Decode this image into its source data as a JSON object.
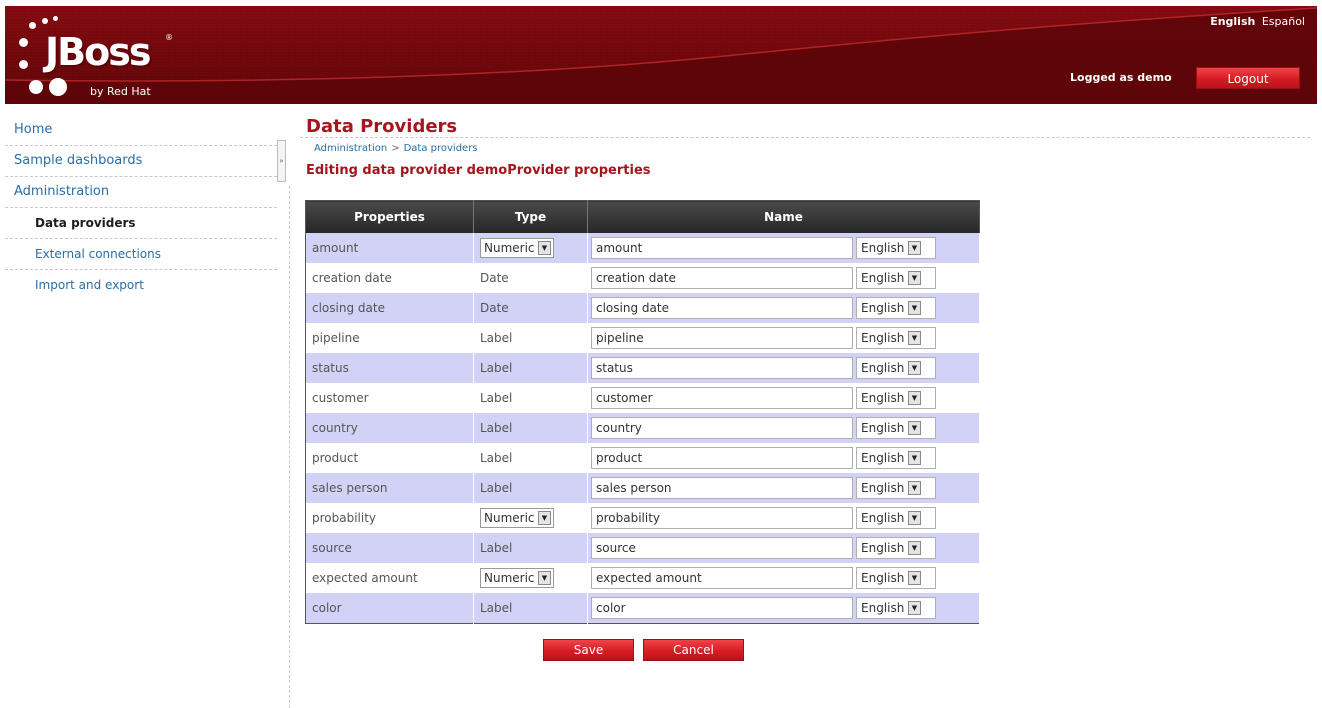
{
  "header": {
    "logo_text": "JBoss",
    "logo_reg": "®",
    "logo_sub": "by Red Hat",
    "languages": [
      "English",
      "Español"
    ],
    "active_language": "English",
    "logged_text": "Logged as demo",
    "logout_label": "Logout"
  },
  "sidebar": {
    "items": [
      {
        "label": "Home",
        "level": 0
      },
      {
        "label": "Sample dashboards",
        "level": 0
      },
      {
        "label": "Administration",
        "level": 0
      },
      {
        "label": "Data providers",
        "level": 1,
        "active": true
      },
      {
        "label": "External connections",
        "level": 1
      },
      {
        "label": "Import and export",
        "level": 1
      }
    ]
  },
  "main": {
    "title": "Data Providers",
    "breadcrumb": [
      "Administration",
      "Data providers"
    ],
    "breadcrumb_sep": ">",
    "subtitle": "Editing data provider demoProvider properties",
    "columns": [
      "Properties",
      "Type",
      "Name"
    ],
    "rows": [
      {
        "property": "amount",
        "type": "Numeric",
        "type_select": true,
        "name": "amount",
        "lang": "English"
      },
      {
        "property": "creation date",
        "type": "Date",
        "type_select": false,
        "name": "creation date",
        "lang": "English"
      },
      {
        "property": "closing date",
        "type": "Date",
        "type_select": false,
        "name": "closing date",
        "lang": "English"
      },
      {
        "property": "pipeline",
        "type": "Label",
        "type_select": false,
        "name": "pipeline",
        "lang": "English"
      },
      {
        "property": "status",
        "type": "Label",
        "type_select": false,
        "name": "status",
        "lang": "English"
      },
      {
        "property": "customer",
        "type": "Label",
        "type_select": false,
        "name": "customer",
        "lang": "English"
      },
      {
        "property": "country",
        "type": "Label",
        "type_select": false,
        "name": "country",
        "lang": "English"
      },
      {
        "property": "product",
        "type": "Label",
        "type_select": false,
        "name": "product",
        "lang": "English"
      },
      {
        "property": "sales person",
        "type": "Label",
        "type_select": false,
        "name": "sales person",
        "lang": "English"
      },
      {
        "property": "probability",
        "type": "Numeric",
        "type_select": true,
        "name": "probability",
        "lang": "English"
      },
      {
        "property": "source",
        "type": "Label",
        "type_select": false,
        "name": "source",
        "lang": "English"
      },
      {
        "property": "expected amount",
        "type": "Numeric",
        "type_select": true,
        "name": "expected amount",
        "lang": "English"
      },
      {
        "property": "color",
        "type": "Label",
        "type_select": false,
        "name": "color",
        "lang": "English"
      }
    ],
    "save_label": "Save",
    "cancel_label": "Cancel"
  },
  "colors": {
    "header_red": "#8f0b12",
    "button_red": "#d61c23",
    "title_red": "#a4161d",
    "link_blue": "#2a6ea6",
    "row_lavender": "#d2d2f7",
    "table_header": "#262626"
  },
  "icons": {
    "select_arrow": "dropdown-arrow-icon",
    "sidebar_handle": "collapse-handle-icon"
  }
}
